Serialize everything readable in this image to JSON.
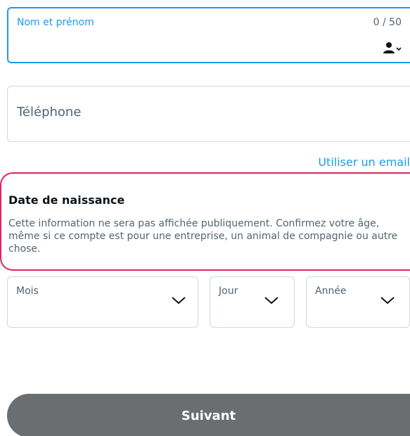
{
  "name_field": {
    "label": "Nom et prénom",
    "counter": "0 / 50",
    "icon": "person-icon",
    "value": ""
  },
  "phone_field": {
    "placeholder": "Téléphone",
    "value": ""
  },
  "use_email_link": "Utiliser un email",
  "dob": {
    "title": "Date de naissance",
    "description": "Cette information ne sera pas affichée publiquement. Confirmez votre âge, même si ce compte est pour une entreprise, un animal de compagnie ou autre chose.",
    "month_label": "Mois",
    "day_label": "Jour",
    "year_label": "Année"
  },
  "next_button": "Suivant",
  "colors": {
    "accent": "#1d9bf0",
    "highlight": "#e0245e",
    "button": "#6b6e71",
    "border": "#cfd9de",
    "muted_text": "#536471"
  }
}
